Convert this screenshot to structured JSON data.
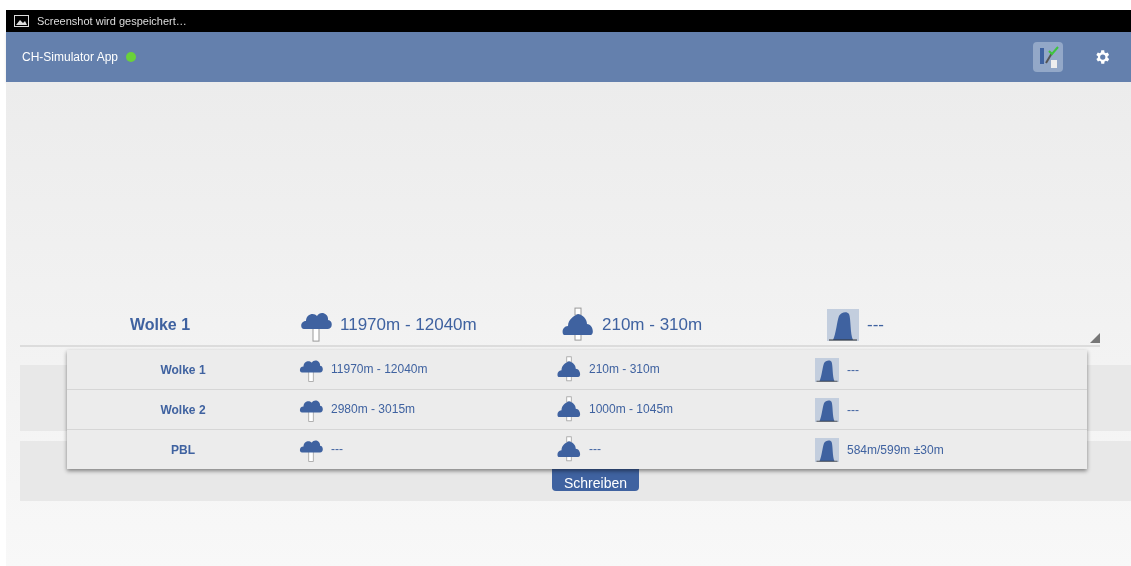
{
  "status_bar": {
    "notification": "Screenshot wird gespeichert…"
  },
  "app_bar": {
    "title": "CH-Simulator App",
    "connected": true
  },
  "selector": {
    "name": "Wolke 1",
    "base": "11970m - 12040m",
    "thickness": "210m - 310m",
    "profile": "---"
  },
  "dropdown": [
    {
      "name": "Wolke 1",
      "base": "11970m - 12040m",
      "thickness": "210m - 310m",
      "profile": "---"
    },
    {
      "name": "Wolke 2",
      "base": "2980m - 3015m",
      "thickness": "1000m - 1045m",
      "profile": "---"
    },
    {
      "name": "PBL",
      "base": "---",
      "thickness": "---",
      "profile": "584m/599m ±30m"
    }
  ],
  "write_button": "Schreiben"
}
